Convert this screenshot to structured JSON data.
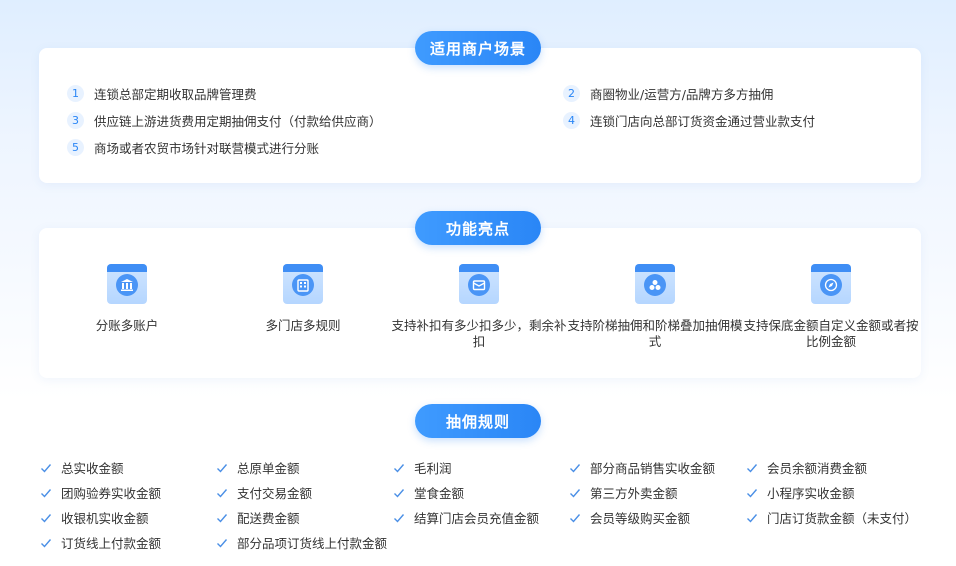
{
  "scenes": {
    "title": "适用商户场景",
    "items": [
      {
        "num": "1",
        "text": "连锁总部定期收取品牌管理费"
      },
      {
        "num": "2",
        "text": "商圈物业/运营方/品牌方多方抽佣"
      },
      {
        "num": "3",
        "text": "供应链上游进货费用定期抽佣支付（付款给供应商）"
      },
      {
        "num": "4",
        "text": "连锁门店向总部订货资金通过营业款支付"
      },
      {
        "num": "5",
        "text": "商场或者农贸市场针对联营模式进行分账"
      }
    ]
  },
  "features": {
    "title": "功能亮点",
    "items": [
      {
        "icon": "bank-icon",
        "text": "分账多账户"
      },
      {
        "icon": "store-icon",
        "text": "多门店多规则"
      },
      {
        "icon": "wallet-icon",
        "text": "支持补扣有多少扣多少，剩余补扣"
      },
      {
        "icon": "tiered-icon",
        "text": "支持阶梯抽佣和阶梯叠加抽佣模式"
      },
      {
        "icon": "compass-icon",
        "text": "支持保底金额自定义金额或者按比例金额"
      }
    ]
  },
  "rules": {
    "title": "抽佣规则",
    "columns": [
      [
        "总实收金额",
        "团购验券实收金额",
        "收银机实收金额",
        "订货线上付款金额"
      ],
      [
        "总原单金额",
        "支付交易金额",
        "配送费金额",
        "部分品项订货线上付款金额"
      ],
      [
        "毛利润",
        "堂食金额",
        "结算门店会员充值金额"
      ],
      [
        "部分商品销售实收金额",
        "第三方外卖金额",
        "会员等级购买金额"
      ],
      [
        "会员余额消费金额",
        "小程序实收金额",
        "门店订货款金额（未支付）"
      ]
    ]
  },
  "colors": {
    "accent": "#2a86f6",
    "check": "#4a8fe6"
  }
}
